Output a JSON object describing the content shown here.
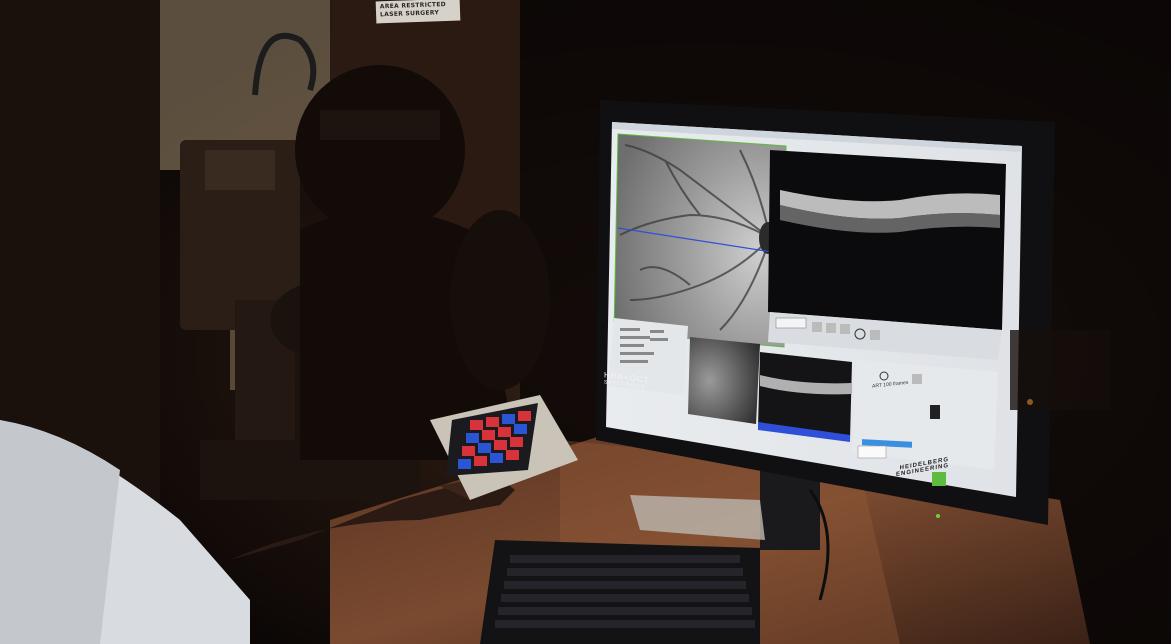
{
  "scene": {
    "wall_sign": {
      "line1": "AREA RESTRICTED",
      "line2": "LASER SURGERY"
    },
    "screen": {
      "device_logo_line1": "HRA+OCT",
      "device_logo_line2": "SPECTRALIS",
      "manufacturer_line1": "HEIDELBERG",
      "manufacturer_line2": "ENGINEERING",
      "art_label": "ART 100 frames"
    },
    "colors": {
      "accent_green": "#5dbb3f",
      "scan_line_blue": "#2f4fd8",
      "key_red": "#d8333b",
      "key_blue": "#2a55d4"
    }
  }
}
